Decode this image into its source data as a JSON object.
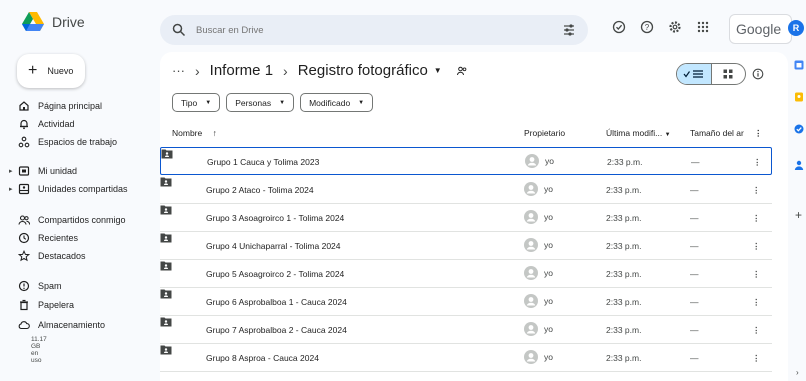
{
  "app": {
    "name": "Drive"
  },
  "search": {
    "placeholder": "Buscar en Drive"
  },
  "header": {
    "google_label": "Google",
    "avatar_initial": "R"
  },
  "sidebar": {
    "new_label": "Nuevo",
    "items": [
      {
        "label": "Página principal",
        "icon": "home-icon"
      },
      {
        "label": "Actividad",
        "icon": "bell-icon"
      },
      {
        "label": "Espacios de trabajo",
        "icon": "workspaces-icon"
      },
      {
        "label": "Mi unidad",
        "icon": "my-drive-icon"
      },
      {
        "label": "Unidades compartidas",
        "icon": "shared-drives-icon"
      },
      {
        "label": "Compartidos conmigo",
        "icon": "people-icon"
      },
      {
        "label": "Recientes",
        "icon": "clock-icon"
      },
      {
        "label": "Destacados",
        "icon": "star-icon"
      },
      {
        "label": "Spam",
        "icon": "spam-icon"
      },
      {
        "label": "Papelera",
        "icon": "trash-icon"
      },
      {
        "label": "Almacenamiento",
        "icon": "cloud-icon"
      }
    ],
    "storage_text": "11.17 GB en uso"
  },
  "breadcrumb": {
    "dots": "···",
    "parent": "Informe 1",
    "current": "Registro fotográfico"
  },
  "filters": [
    {
      "label": "Tipo"
    },
    {
      "label": "Personas"
    },
    {
      "label": "Modificado"
    }
  ],
  "table": {
    "headers": {
      "name": "Nombre",
      "owner": "Propietario",
      "modified": "Última modifi...",
      "size": "Tamaño del ar"
    },
    "rows": [
      {
        "name": "Grupo 1 Cauca y Tolima 2023",
        "owner": "yo",
        "modified": "2:33 p.m.",
        "size": "—"
      },
      {
        "name": "Grupo 2 Ataco - Tolima 2024",
        "owner": "yo",
        "modified": "2:33 p.m.",
        "size": "—"
      },
      {
        "name": "Grupo 3 Asoagroirco 1 - Tolima 2024",
        "owner": "yo",
        "modified": "2:33 p.m.",
        "size": "—"
      },
      {
        "name": "Grupo 4 Unichaparral - Tolima 2024",
        "owner": "yo",
        "modified": "2:33 p.m.",
        "size": "—"
      },
      {
        "name": "Grupo 5 Asoagroirco 2 - Tolima 2024",
        "owner": "yo",
        "modified": "2:33 p.m.",
        "size": "—"
      },
      {
        "name": "Grupo 6 Asprobalboa 1 - Cauca 2024",
        "owner": "yo",
        "modified": "2:33 p.m.",
        "size": "—"
      },
      {
        "name": "Grupo 7 Asprobalboa 2 - Cauca 2024",
        "owner": "yo",
        "modified": "2:33 p.m.",
        "size": "—"
      },
      {
        "name": "Grupo 8 Asproa - Cauca 2024",
        "owner": "yo",
        "modified": "2:33 p.m.",
        "size": "—"
      }
    ]
  },
  "colors": {
    "accent": "#0b57d0",
    "search_bg": "#e9eef6",
    "toggle_on": "#c2e7ff",
    "page_bg": "#f8fafd"
  }
}
